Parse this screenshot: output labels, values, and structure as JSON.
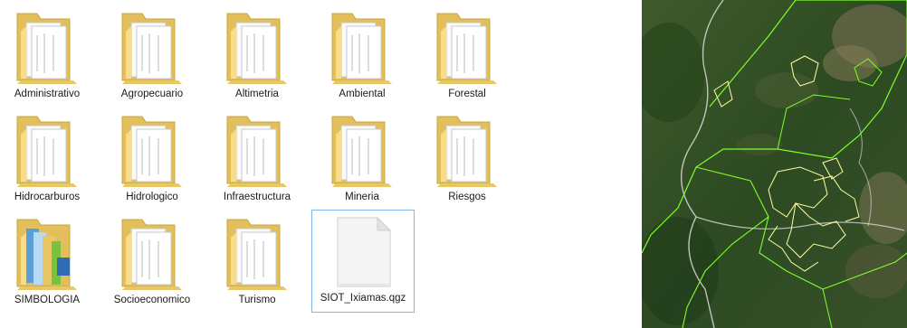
{
  "explorer": {
    "items": [
      {
        "label": "Administrativo",
        "icon": "folder-icon",
        "type": "folder"
      },
      {
        "label": "Agropecuario",
        "icon": "folder-icon",
        "type": "folder"
      },
      {
        "label": "Altimetria",
        "icon": "folder-icon",
        "type": "folder"
      },
      {
        "label": "Ambiental",
        "icon": "folder-icon",
        "type": "folder"
      },
      {
        "label": "Forestal",
        "icon": "folder-icon",
        "type": "folder"
      },
      {
        "label": "Hidrocarburos",
        "icon": "folder-icon",
        "type": "folder"
      },
      {
        "label": "Hidrologico",
        "icon": "folder-icon",
        "type": "folder"
      },
      {
        "label": "Infraestructura",
        "icon": "folder-icon",
        "type": "folder"
      },
      {
        "label": "Mineria",
        "icon": "folder-icon",
        "type": "folder"
      },
      {
        "label": "Riesgos",
        "icon": "folder-icon",
        "type": "folder"
      },
      {
        "label": "SIMBOLOGIA",
        "icon": "folder-colored-icon",
        "type": "folder"
      },
      {
        "label": "Socioeconomico",
        "icon": "folder-icon",
        "type": "folder"
      },
      {
        "label": "Turismo",
        "icon": "folder-icon",
        "type": "folder"
      },
      {
        "label": "SIOT_Ixiamas.qgz",
        "icon": "file-icon",
        "type": "file",
        "selected": true
      }
    ]
  },
  "colors": {
    "folder_back": "#e8c766",
    "folder_front": "#f7dc8c",
    "selection_border": "#7fb7e8",
    "map_boundary_green": "#7dff2a",
    "map_parcel_yellow": "#ffff9e",
    "map_gray_line": "#d8d8d8"
  }
}
